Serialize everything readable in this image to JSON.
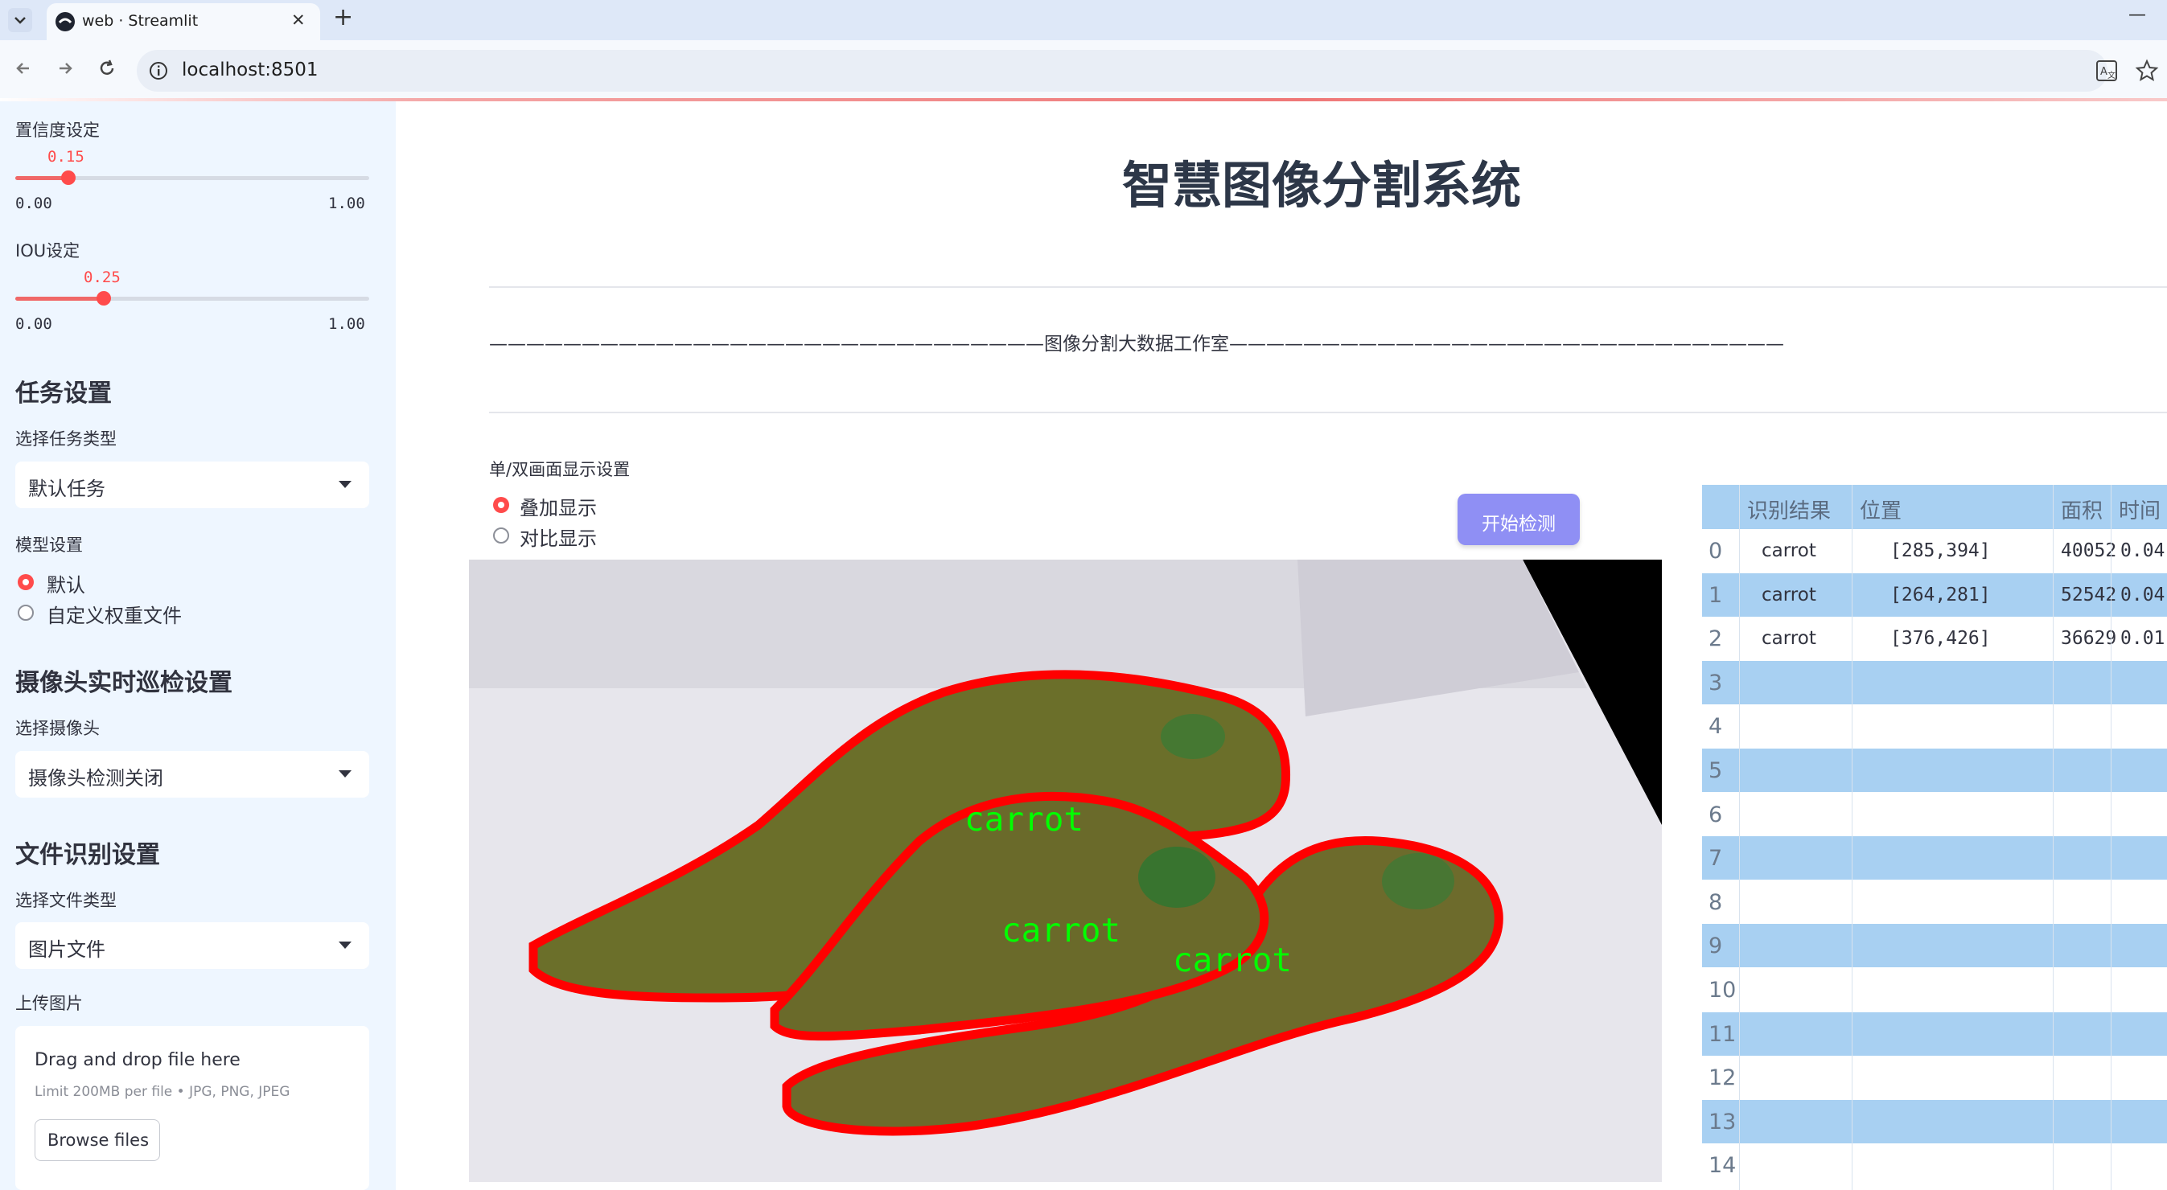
{
  "browser": {
    "tab_title": "web · Streamlit",
    "new_tab_glyph": "+",
    "close_glyph": "✕",
    "minimize_glyph": "—",
    "url": "localhost:8501"
  },
  "sidebar": {
    "confidence": {
      "label": "置信度设定",
      "value": "0.15",
      "fraction": 0.15,
      "min": "0.00",
      "max": "1.00"
    },
    "iou": {
      "label": "IOU设定",
      "value": "0.25",
      "fraction": 0.25,
      "min": "0.00",
      "max": "1.00"
    },
    "task_section": {
      "heading": "任务设置",
      "select_label": "选择任务类型",
      "selected": "默认任务"
    },
    "model_section": {
      "label": "模型设置",
      "options": [
        "默认",
        "自定义权重文件"
      ],
      "selected_index": 0
    },
    "camera_section": {
      "heading": "摄像头实时巡检设置",
      "select_label": "选择摄像头",
      "selected": "摄像头检测关闭"
    },
    "file_section": {
      "heading": "文件识别设置",
      "select_label": "选择文件类型",
      "selected": "图片文件"
    },
    "upload": {
      "label": "上传图片",
      "drop_text": "Drag and drop file here",
      "limit_text": "Limit 200MB per file • JPG, PNG, JPEG",
      "browse_label": "Browse files"
    }
  },
  "main": {
    "title": "智慧图像分割系统",
    "studio_line": "——————————————————————————————图像分割大数据工作室——————————————————————————————",
    "display_setting_label": "单/双画面显示设置",
    "display_options": [
      "叠加显示",
      "对比显示"
    ],
    "display_selected_index": 0,
    "detect_button": "开始检测",
    "detections": [
      {
        "label": "carrot"
      },
      {
        "label": "carrot"
      },
      {
        "label": "carrot"
      }
    ]
  },
  "table": {
    "columns": [
      "识别结果",
      "位置",
      "面积",
      "时间"
    ],
    "rows": [
      {
        "index": "0",
        "result": "carrot",
        "position": "[285,394]",
        "area": "40052",
        "time": "0.04"
      },
      {
        "index": "1",
        "result": "carrot",
        "position": "[264,281]",
        "area": "52542",
        "time": "0.04"
      },
      {
        "index": "2",
        "result": "carrot",
        "position": "[376,426]",
        "area": "36629",
        "time": "0.01"
      },
      {
        "index": "3"
      },
      {
        "index": "4"
      },
      {
        "index": "5"
      },
      {
        "index": "6"
      },
      {
        "index": "7"
      },
      {
        "index": "8"
      },
      {
        "index": "9"
      },
      {
        "index": "10"
      },
      {
        "index": "11"
      },
      {
        "index": "12"
      },
      {
        "index": "13"
      },
      {
        "index": "14"
      }
    ]
  },
  "colors": {
    "accent": "#ff4b4b",
    "sidebar_bg": "#eef6ff",
    "button_bg": "#8f8ff4",
    "table_header": "#a8d0f2",
    "table_stripe": "#a8d0f2",
    "mask_outline": "#ff0000",
    "label_text": "#00ff00"
  }
}
